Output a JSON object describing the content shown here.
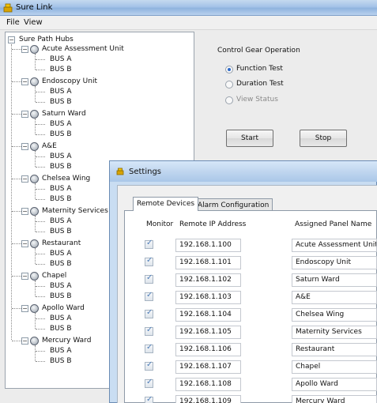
{
  "window": {
    "title": "Sure Link"
  },
  "menu": {
    "file": "File",
    "view": "View"
  },
  "tree": {
    "root": "Sure Path Hubs",
    "hubs": [
      {
        "name": "Acute Assessment Unit",
        "buses": [
          "BUS A",
          "BUS B"
        ]
      },
      {
        "name": "Endoscopy Unit",
        "buses": [
          "BUS A",
          "BUS B"
        ]
      },
      {
        "name": "Saturn Ward",
        "buses": [
          "BUS A",
          "BUS B"
        ]
      },
      {
        "name": "A&E",
        "buses": [
          "BUS A",
          "BUS B"
        ]
      },
      {
        "name": "Chelsea Wing",
        "buses": [
          "BUS A",
          "BUS B"
        ]
      },
      {
        "name": "Maternity Services",
        "buses": [
          "BUS A",
          "BUS B"
        ]
      },
      {
        "name": "Restaurant",
        "buses": [
          "BUS A",
          "BUS B"
        ]
      },
      {
        "name": "Chapel",
        "buses": [
          "BUS A",
          "BUS B"
        ]
      },
      {
        "name": "Apollo Ward",
        "buses": [
          "BUS A",
          "BUS B"
        ]
      },
      {
        "name": "Mercury Ward",
        "buses": [
          "BUS A",
          "BUS B"
        ]
      }
    ]
  },
  "control": {
    "label": "Control Gear Operation",
    "options": [
      {
        "label": "Function Test",
        "selected": true,
        "enabled": true
      },
      {
        "label": "Duration Test",
        "selected": false,
        "enabled": true
      },
      {
        "label": "View Status",
        "selected": false,
        "enabled": false
      }
    ],
    "start": "Start",
    "stop": "Stop"
  },
  "settings": {
    "title": "Settings",
    "tabs": [
      "Remote Devices",
      "Alarm Configuration"
    ],
    "columns": {
      "monitor": "Monitor",
      "ip": "Remote IP Address",
      "panel": "Assigned Panel Name"
    },
    "rows": [
      {
        "monitor": true,
        "ip": "192.168.1.100",
        "panel": "Acute Assessment Unit"
      },
      {
        "monitor": true,
        "ip": "192.168.1.101",
        "panel": "Endoscopy Unit"
      },
      {
        "monitor": true,
        "ip": "192.168.1.102",
        "panel": "Saturn Ward"
      },
      {
        "monitor": true,
        "ip": "192.168.1.103",
        "panel": "A&E"
      },
      {
        "monitor": true,
        "ip": "192.168.1.104",
        "panel": "Chelsea Wing"
      },
      {
        "monitor": true,
        "ip": "192.168.1.105",
        "panel": "Maternity Services"
      },
      {
        "monitor": true,
        "ip": "192.168.1.106",
        "panel": "Restaurant"
      },
      {
        "monitor": true,
        "ip": "192.168.1.107",
        "panel": "Chapel"
      },
      {
        "monitor": true,
        "ip": "192.168.1.108",
        "panel": "Apollo Ward"
      },
      {
        "monitor": true,
        "ip": "192.168.1.109",
        "panel": "Mercury Ward"
      }
    ]
  }
}
